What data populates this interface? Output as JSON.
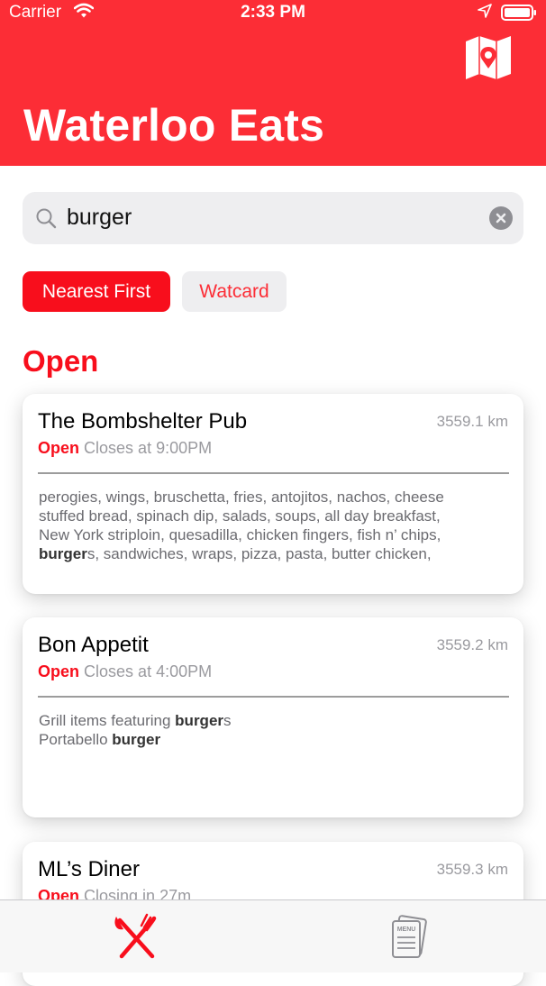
{
  "status_bar": {
    "carrier": "Carrier",
    "time": "2:33 PM"
  },
  "header": {
    "title": "Waterloo Eats",
    "map_icon": "map-location-icon"
  },
  "search": {
    "value": "burger",
    "icon": "search-icon",
    "clear_icon": "clear-icon"
  },
  "filters": [
    {
      "label": "Nearest First",
      "selected": true
    },
    {
      "label": "Watcard",
      "selected": false
    }
  ],
  "section": {
    "title": "Open"
  },
  "restaurants": [
    {
      "name": "The Bombshelter Pub",
      "distance": "3559.1 km",
      "status": "Open",
      "hours": "Closes at 9:00PM",
      "menu_lines": [
        [
          "perogies, wings, bruschetta, fries, antojitos, nachos, cheese"
        ],
        [
          "stuffed bread, spinach dip, salads, soups, all day breakfast,"
        ],
        [
          "New York striploin, quesadilla, chicken fingers, fish n’ chips,"
        ],
        [
          "burger",
          "s, sandwiches, wraps, pizza, pasta, butter chicken,"
        ]
      ]
    },
    {
      "name": "Bon Appetit",
      "distance": "3559.2 km",
      "status": "Open",
      "hours": "Closes at 4:00PM",
      "menu_lines": [
        [
          "Grill items featuring ",
          "burger",
          "s"
        ],
        [
          "Portabello ",
          "burger"
        ]
      ]
    },
    {
      "name": "ML’s Diner",
      "distance": "3559.3 km",
      "status": "Open",
      "hours": "Closing in 27m"
    }
  ],
  "tabbar": {
    "tabs": [
      {
        "icon": "fork-knife-icon",
        "selected": true
      },
      {
        "icon": "menu-icon",
        "selected": false
      }
    ]
  },
  "colors": {
    "accent": "#fc2d36",
    "open_red": "#f80e1c",
    "muted_gray": "#9a9a9f"
  }
}
